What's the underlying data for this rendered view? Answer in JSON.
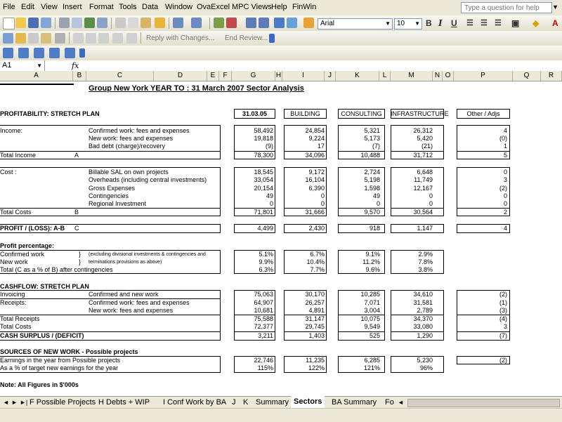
{
  "menu": [
    "File",
    "Edit",
    "View",
    "Insert",
    "Format",
    "Tools",
    "Data",
    "Window",
    "OvaExcel",
    "MPC Views",
    "Help",
    "FinWin"
  ],
  "help_placeholder": "Type a question for help",
  "toolbar": {
    "font": "Arial",
    "size": "10",
    "reply_text": "Reply with Changes...",
    "end_review": "End Review..."
  },
  "namebox": "A1",
  "fx": "fx",
  "columns": [
    "A",
    "B",
    "C",
    "D",
    "E",
    "F",
    "G",
    "H",
    "I",
    "J",
    "K",
    "L",
    "M",
    "N",
    "O",
    "P",
    "Q",
    "R"
  ],
  "sheet": {
    "title": "Group New York YEAR TO : 31 March 2007 Sector Analysis",
    "profit_plan_heading": "PROFITABILITY: STRETCH PLAN",
    "col_headers": [
      "31.03.05",
      "BUILDING",
      "CONSULTING",
      "INFRASTRUCTURE",
      "Other / Adjs"
    ],
    "income_label": "Income:",
    "income_rows": [
      {
        "desc": "Confirmed work: fees and expenses",
        "v": [
          "58,492",
          "24,854",
          "5,321",
          "26,312",
          "4"
        ]
      },
      {
        "desc": "New work: fees and expenses",
        "v": [
          "19,818",
          "9,224",
          "5,173",
          "5,420",
          "(0)"
        ]
      },
      {
        "desc": "Bad debt (charge)/recovery",
        "v": [
          "(9)",
          "17",
          "(7)",
          "(21)",
          "1"
        ]
      }
    ],
    "total_income": {
      "label": "Total  Income",
      "key": "A",
      "v": [
        "78,300",
        "34,096",
        "10,488",
        "31,712",
        "5"
      ]
    },
    "cost_label": "Cost :",
    "cost_rows": [
      {
        "desc": "Billable SAL on own projects",
        "v": [
          "18,545",
          "9,172",
          "2,724",
          "6,648",
          "0"
        ]
      },
      {
        "desc": "Overheads (including central investments)",
        "v": [
          "33,054",
          "16,104",
          "5,198",
          "11,749",
          "3"
        ]
      },
      {
        "desc": "Gross Expenses",
        "v": [
          "20,154",
          "6,390",
          "1,598",
          "12,167",
          "(2)"
        ]
      },
      {
        "desc": "Contingencies",
        "v": [
          "49",
          "0",
          "49",
          "0",
          "0"
        ]
      },
      {
        "desc": "Regional Investment",
        "v": [
          "0",
          "0",
          "0",
          "0",
          "0"
        ]
      }
    ],
    "total_costs": {
      "label": "Total  Costs",
      "key": "B",
      "v": [
        "71,801",
        "31,666",
        "9,570",
        "30,564",
        "2"
      ]
    },
    "profit_loss": {
      "label": "PROFIT / (LOSS): A-B",
      "key": "C",
      "v": [
        "4,499",
        "2,430",
        "918",
        "1,147",
        "4"
      ]
    },
    "profit_pct_heading": "Profit percentage:",
    "profit_pct_rows": [
      {
        "label": "Confirmed work",
        "brace": "}",
        "note": "(excluding divisional investments & contingencies and",
        "v": [
          "5.1%",
          "6.7%",
          "9.1%",
          "2.9%"
        ]
      },
      {
        "label": "New work",
        "brace": "}",
        "note": "terminations provisions as above)",
        "v": [
          "9.9%",
          "10.4%",
          "11.2%",
          "7.8%"
        ]
      },
      {
        "label": "Total (C as a % of B) after contingencies",
        "brace": "",
        "note": "",
        "v": [
          "6.3%",
          "7.7%",
          "9.6%",
          "3.8%"
        ]
      }
    ],
    "cashflow_heading": "CASHFLOW: STRETCH PLAN",
    "cashflow_rows": [
      {
        "label": "Invoicing",
        "desc": "Confirmed and new work",
        "v": [
          "75,063",
          "30,170",
          "10,285",
          "34,610",
          "(2)"
        ]
      },
      {
        "label": "Receipts:",
        "desc": "Confirmed work: fees and expenses",
        "v": [
          "64,907",
          "26,257",
          "7,071",
          "31,581",
          "(1)"
        ]
      },
      {
        "label": "",
        "desc": "New work: fees and expenses",
        "v": [
          "10,681",
          "4,891",
          "3,004",
          "2,789",
          "(3)"
        ]
      },
      {
        "label": "Total Receipts",
        "desc": "",
        "v": [
          "75,588",
          "31,147",
          "10,075",
          "34,370",
          "(4)"
        ]
      },
      {
        "label": "Total Costs",
        "desc": "",
        "v": [
          "72,377",
          "29,745",
          "9,549",
          "33,080",
          "3"
        ]
      },
      {
        "label": "CASH SURPLUS / (DEFICIT)",
        "desc": "",
        "v": [
          "3,211",
          "1,403",
          "525",
          "1,290",
          "(7)"
        ]
      }
    ],
    "sources_heading": "SOURCES OF NEW WORK - Possible projects",
    "sources_rows": [
      {
        "label": "Earnings in the year from Possible projects",
        "v": [
          "22,746",
          "11,235",
          "6,285",
          "5,230",
          "(2)"
        ]
      },
      {
        "label": "As a % of target new earnings for the year",
        "v": [
          "115%",
          "122%",
          "121%",
          "96%",
          ""
        ]
      }
    ],
    "note": "Note: All Figures in $'000s"
  },
  "tabs": [
    "F Possible Projects",
    "H Debts + WIP",
    "I Conf Work by BA",
    "J",
    "K",
    "Summary",
    "Sectors",
    "BA Summary",
    "Fo"
  ],
  "active_tab": "Sectors",
  "colors": {
    "chrome": "#ece9d8",
    "grid_border": "#000000"
  }
}
